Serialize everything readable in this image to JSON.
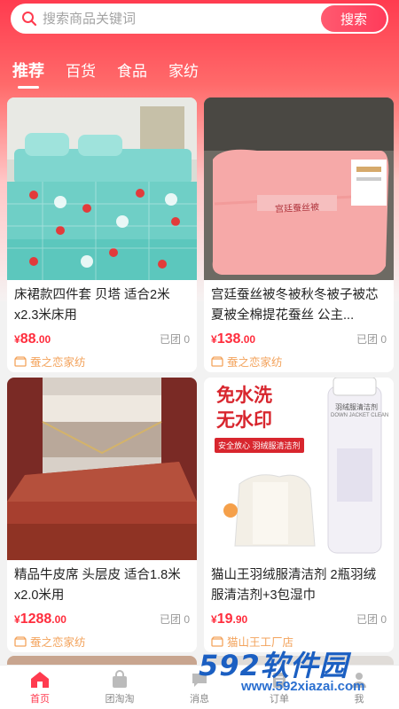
{
  "search": {
    "placeholder": "搜索商品关键词",
    "button_label": "搜索"
  },
  "tabs": [
    {
      "label": "推荐",
      "active": true
    },
    {
      "label": "百货",
      "active": false
    },
    {
      "label": "食品",
      "active": false
    },
    {
      "label": "家纺",
      "active": false
    }
  ],
  "products": [
    {
      "title": "床裙款四件套 贝塔 适合2米x2.3米床用",
      "price_symbol": "¥",
      "price_int": "88",
      "price_dec": ".00",
      "sold": "已团 0",
      "shop": "蚕之恋家纺"
    },
    {
      "title": "宫廷蚕丝被冬被秋冬被子被芯夏被全棉提花蚕丝 公主...",
      "price_symbol": "¥",
      "price_int": "138",
      "price_dec": ".00",
      "sold": "已团 0",
      "shop": "蚕之恋家纺",
      "image_text": "宫廷蚕丝被"
    },
    {
      "title": "精品牛皮席 头层皮 适合1.8米x2.0米用",
      "price_symbol": "¥",
      "price_int": "1288",
      "price_dec": ".00",
      "sold": "已团 0",
      "shop": "蚕之恋家纺"
    },
    {
      "title": "猫山王羽绒服清洁剂 2瓶羽绒服清洁剂+3包湿巾",
      "price_symbol": "¥",
      "price_int": "19",
      "price_dec": ".90",
      "sold": "已团 0",
      "shop": "猫山王工厂店",
      "image_text": {
        "line1": "免水洗",
        "line2": "无水印",
        "tag": "安全放心  羽绒服清洁剂",
        "bottle_label": "羽绒服清洁剂",
        "bottle_en": "DOWN JACKET CLEAN"
      }
    }
  ],
  "tabbar": [
    {
      "label": "首页",
      "icon": "home-icon",
      "active": true
    },
    {
      "label": "团淘淘",
      "icon": "bag-icon",
      "active": false
    },
    {
      "label": "消息",
      "icon": "message-icon",
      "active": false
    },
    {
      "label": "订单",
      "icon": "order-icon",
      "active": false
    },
    {
      "label": "我",
      "icon": "user-icon",
      "active": false
    }
  ],
  "watermark": {
    "logo": "592软件园",
    "url": "www.592xiazai.com"
  },
  "colors": {
    "brand": "#ff3b4f",
    "price": "#ff2d3d",
    "shop": "#f3a35c",
    "watermark": "#1b5fc2"
  }
}
